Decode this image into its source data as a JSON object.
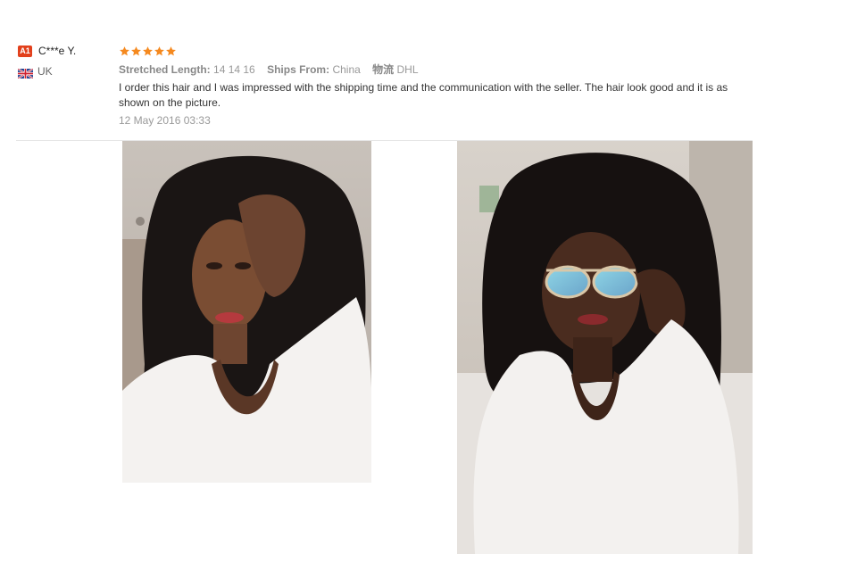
{
  "reviewer": {
    "level_badge": "A1",
    "name": "C***e Y.",
    "country_flag_icon": "uk-flag-icon",
    "country": "UK"
  },
  "review": {
    "rating": 5,
    "rating_max": 5,
    "star_color": "#f5891f",
    "attributes": [
      {
        "key": "Stretched Length:",
        "value": "14 14 16"
      },
      {
        "key": "Ships From:",
        "value": "China"
      }
    ],
    "shipping_method_icon": "logistics-icon",
    "shipping_method_cn": "物流",
    "shipping_method": "DHL",
    "text": "I order this hair and I was impressed with the shipping time and the communication with the seller. The hair look good and it is as shown on the picture.",
    "date": "12 May 2016 03:33"
  },
  "photos": [
    {
      "name": "review-photo-1"
    },
    {
      "name": "review-photo-2"
    }
  ]
}
